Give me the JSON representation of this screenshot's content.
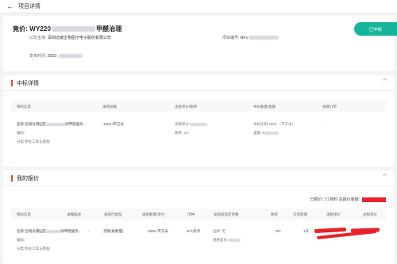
{
  "header": {
    "back_icon": "arrow-left-icon",
    "title": "项目详情"
  },
  "project": {
    "label": "竟价:",
    "code_prefix": "WY220",
    "name_suffix": "甲醛治理",
    "company_label": "公司主体:",
    "company_value": "深圳迈瑞生物医疗电子股份有限公司",
    "project_no_label": "项目编号:",
    "project_no_value": "RFx",
    "publish_label": "发布时间:",
    "publish_value": "2022-",
    "status": "已中标",
    "status_color": "#16b49a"
  },
  "award": {
    "section_title": "中标详情",
    "accent_color": "#e0482c",
    "columns": [
      "物料信息",
      "采购总数",
      "含税单价/税率",
      "中标数量/金额",
      "关联订单"
    ],
    "row": {
      "name_label": "名称:",
      "name_value": "迈瑞光明园区",
      "name_tail": "除甲醛服务...",
      "code_label": "编码:",
      "code_value": "-",
      "category_label": "分类:",
      "category_value": "物业工程与客服",
      "quantity": "1500 /平方米",
      "unit_price_label": "含税单价:",
      "tax_label": "税率:",
      "tax_value": "3%",
      "award_ratio_label": "中标比例:",
      "award_ratio_value": "1500 （平方米）",
      "amount_label": "金额:",
      "amount_value": "¥",
      "order": "-"
    }
  },
  "quote": {
    "section_title": "我的报价",
    "summary_prefix": "已报价:",
    "summary_count": "1/1",
    "summary_suffix": "物料 总报价金额:",
    "columns": [
      "物料信息",
      "详细描述",
      "采购行类型",
      "采购数量/单位",
      "币种",
      "采购商指定参数",
      "税率",
      "交货周期",
      "未税单价",
      "含税单价"
    ],
    "row": {
      "name_label": "名称:",
      "name_value": "迈瑞光明园区",
      "name_tail": "除甲醛服务...",
      "code_label": "编码:",
      "code_value": "-",
      "category_label": "分类:",
      "category_value": "物业工程与客服",
      "description": "-",
      "line_type": "货物(按数量)",
      "quantity": "1500 /平方米",
      "currency": "¥/人民币",
      "brand_label": "品牌:",
      "brand_value": "无",
      "spec_label": "规格型号:",
      "tax": "3%",
      "delivery": "1天"
    }
  }
}
